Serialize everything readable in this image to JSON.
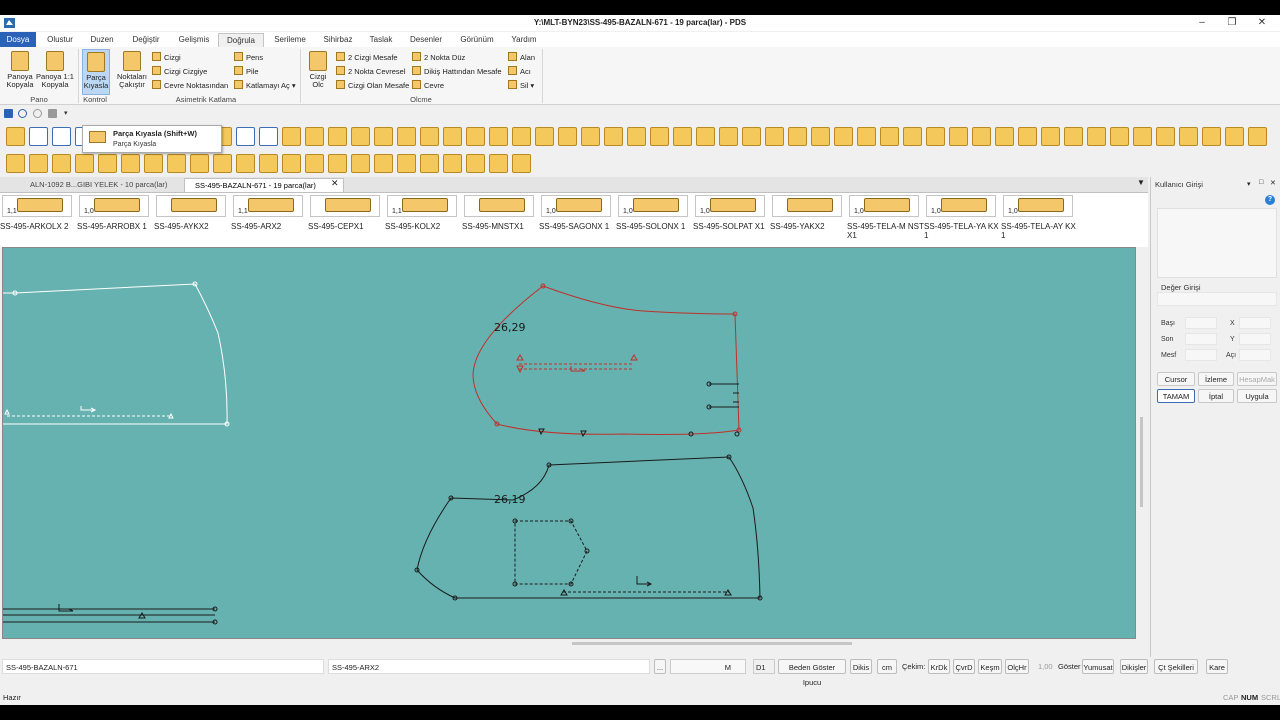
{
  "window": {
    "title": "Y:\\MLT-BYN23\\SS-495-BAZALN-671  -  19 parca(lar)  -  PDS",
    "controls": [
      "minimize",
      "maximize",
      "close"
    ],
    "user_id": "1668270875"
  },
  "menu": {
    "file": "Dosya",
    "items": [
      "Olustur",
      "Duzen",
      "Değiştir",
      "Gelişmis",
      "Doğrula",
      "Serileme",
      "Sihirbaz",
      "Taslak",
      "Desenler",
      "Görünüm",
      "Yardım"
    ],
    "active": "Doğrula"
  },
  "ribbon": {
    "pano_copy": "Panoya Kopyala",
    "pano_copy_11": "Panoya 1:1 Kopyala",
    "part_compare": "Parça Kıyasla",
    "points_overlap": "Noktaları Çakıştır",
    "line": "Cizgi",
    "line_to_line": "Cizgi Cizgiye",
    "perimeter_points": "Cevre Noktasından",
    "dart": "Pens",
    "pleat": "Pile",
    "fold_open": "Katlamayı Aç",
    "line_measure": "Cizgi Olc",
    "two_lines_distance": "2 Cizgi Mesafe",
    "two_points_perimeter": "2 Nokta Cevresel",
    "line_distance": "Cizgi Olan Mesafe",
    "two_points_straight": "2 Nokta Düz",
    "seam_distance": "Dikiş Hattından Mesafe",
    "perimeter": "Cevre",
    "area": "Alan",
    "angle": "Acı",
    "delete": "Sil",
    "groups": [
      "Pano",
      "Kontrol",
      "Asimetrik Katlama",
      "Olcme"
    ]
  },
  "tooltip": {
    "title": "Parça Kıyasla (Shift+W)",
    "desc": "Parça Kıyasla"
  },
  "doc_tabs": [
    {
      "label": "ALN-1092 B...GIBI YELEK  -  10 parca(lar)",
      "active": false
    },
    {
      "label": "SS-495-BAZALN-671  -  19 parca(lar)",
      "active": true
    }
  ],
  "pieces": [
    {
      "scale": "1,1",
      "name": "SS-495-ARKOLX 2"
    },
    {
      "scale": "1,0",
      "name": "SS-495-ARROBX 1"
    },
    {
      "scale": "",
      "name": "SS-495-AYKX2"
    },
    {
      "scale": "1,1",
      "name": "SS-495-ARX2"
    },
    {
      "scale": "",
      "name": "SS-495-CEPX1"
    },
    {
      "scale": "1,1",
      "name": "SS-495-KOLX2"
    },
    {
      "scale": "",
      "name": "SS-495-MNSTX1"
    },
    {
      "scale": "1,0",
      "name": "SS-495-SAGONX 1"
    },
    {
      "scale": "1,0",
      "name": "SS-495-SOLONX 1"
    },
    {
      "scale": "1,0",
      "name": "SS-495-SOLPAT X1"
    },
    {
      "scale": "",
      "name": "SS-495-YAKX2"
    },
    {
      "scale": "1,0",
      "name": "SS-495-TELA-M NSTX1"
    },
    {
      "scale": "1,0",
      "name": "SS-495-TELA-YA KX1"
    },
    {
      "scale": "1,0",
      "name": "SS-495-TELA-AY KX1"
    }
  ],
  "canvas": {
    "label_top": "26,29",
    "label_bottom": "26,19",
    "colors": {
      "background": "#66b2b0",
      "red_outline": "#c0302a",
      "black_outline": "#1a1a1a",
      "white_outline": "#ffffff"
    }
  },
  "status": {
    "left_field": "SS-495-BAZALN-671",
    "mid_field": "SS-495-ARX2",
    "ellipsis": "...",
    "size": "M",
    "d1": "D1",
    "beden": "Beden Göster Ipucu",
    "dikis": "Dikis",
    "cm": "cm",
    "cekim": "Çekim:",
    "krdk": "KrDk",
    "cvrd": "ÇvrD",
    "kesm": "Keşm",
    "olchr": "OlçHr",
    "value": "1,00",
    "goster": "Göster",
    "yumusat": "Yumusat",
    "dikisler": "Dikişler",
    "ct_sekilleri": "Çt Şekilleri",
    "kare": "Kare",
    "ready": "Hazır",
    "indicators": [
      "CAP",
      "NUM",
      "SCRL"
    ]
  },
  "side_panel": {
    "title": "Kullanıcı Girişi",
    "value_label": "Değer Girişi",
    "bas": "Başı",
    "son": "Son",
    "mesf": "Mesf",
    "x": "X",
    "y": "Y",
    "aci": "Açı",
    "cursor": "Cursor",
    "izleme": "İzleme",
    "hesapmak": "HesapMak",
    "tamam": "TAMAM",
    "iptal": "İptal",
    "uygula": "Uygula"
  }
}
